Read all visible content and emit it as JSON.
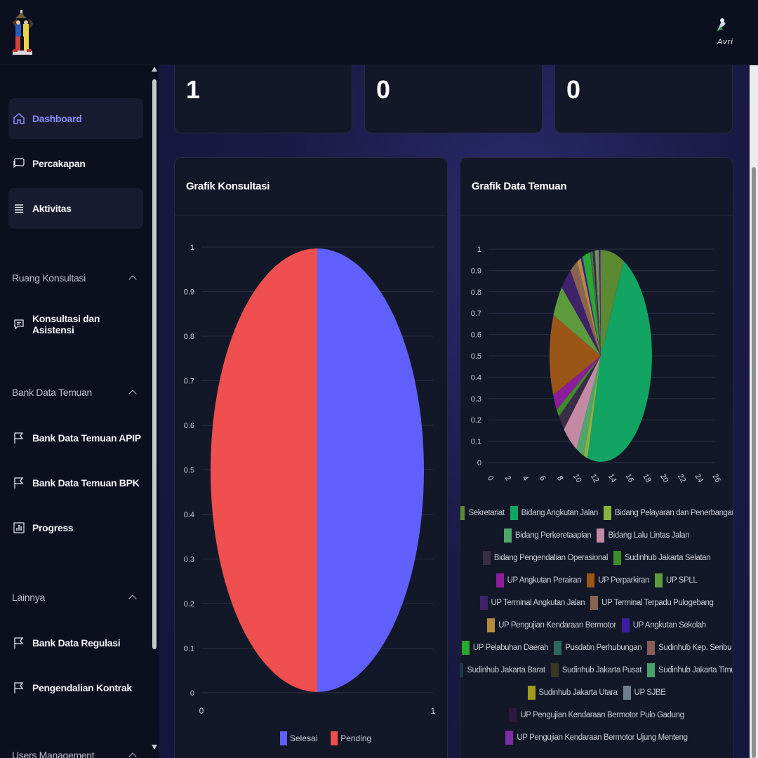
{
  "header": {
    "user_label": "Avri"
  },
  "sidebar": {
    "items": [
      {
        "label": "Dashboard"
      },
      {
        "label": "Percakapan"
      },
      {
        "label": "Aktivitas"
      }
    ],
    "sections": [
      {
        "title": "Ruang Konsultasi",
        "items": [
          {
            "label": "Konsultasi dan Asistensi"
          }
        ]
      },
      {
        "title": "Bank Data Temuan",
        "items": [
          {
            "label": "Bank Data Temuan APIP"
          },
          {
            "label": "Bank Data Temuan BPK"
          },
          {
            "label": "Progress"
          }
        ]
      },
      {
        "title": "Lainnya",
        "items": [
          {
            "label": "Bank Data Regulasi"
          },
          {
            "label": "Pengendalian Kontrak"
          }
        ]
      },
      {
        "title": "Users Management"
      }
    ]
  },
  "stats": [
    {
      "value": "1"
    },
    {
      "value": "0"
    },
    {
      "value": "0"
    }
  ],
  "chart_data": [
    {
      "type": "pie",
      "title": "Grafik Konsultasi",
      "labels": [
        "Selesai",
        "Pending"
      ],
      "values": [
        1,
        1
      ],
      "colors": [
        "#6060ff",
        "#ef4f4f"
      ],
      "y_ticks": [
        "1",
        "0.9",
        "0.8",
        "0.7",
        "0.6",
        "0.5",
        "0.4",
        "0.3",
        "0.2",
        "0.1",
        "0"
      ],
      "x_ticks": [
        "0",
        "1"
      ],
      "legend_position": "bottom"
    },
    {
      "type": "pie",
      "title": "Grafik Data Temuan",
      "labels": [
        "Sekretariat",
        "Bidang Angkutan Jalan",
        "Bidang Pelayaran dan Penerbangan",
        "Bidang Perkeretaapian",
        "Bidang Lalu Lintas Jalan",
        "Bidang Pengendalian Operasional",
        "Sudinhub Jakarta Selatan",
        "UP Angkutan Perairan",
        "UP Perparkiran",
        "UP SPLL",
        "UP Terminal Angkutan Jalan",
        "UP Terminal Terpadu Pulogebang",
        "UP Pengujian Kendaraan Bermotor",
        "UP Angkutan Sekolah",
        "UP Pelabuhan Daerah",
        "Pusdatin Perhubungan",
        "Sudinhub Kep. Seribu",
        "Sudinhub Jakarta Barat",
        "Sudinhub Jakarta Pusat",
        "Sudinhub Jakarta Timur",
        "Sudinhub Jakarta Utara",
        "UP SJBE",
        "UP Pengujian Kendaraan Bermotor Pulo Gadung",
        "UP Pengujian Kendaraan Bermotor Ujung Menteng"
      ],
      "values": [
        6,
        38,
        1,
        2,
        4,
        2,
        1,
        2,
        10,
        4,
        3,
        2,
        1,
        0.5,
        2,
        0.3,
        0.3,
        0.3,
        0.3,
        0.3,
        0.3,
        0.5,
        0.2,
        0.2
      ],
      "colors": [
        "#5b8a32",
        "#11a463",
        "#8bb23e",
        "#4fa66a",
        "#c48aa4",
        "#3a2d46",
        "#3d8b2a",
        "#8d1e9b",
        "#9b5617",
        "#5c9a3d",
        "#40226b",
        "#8a6451",
        "#b88a3c",
        "#3b1ea3",
        "#2aa632",
        "#2d6a5a",
        "#8a5c5a",
        "#1d3a46",
        "#3a3823",
        "#4aa06e",
        "#a29a1c",
        "#6f7f8f",
        "#2e1a3c",
        "#7d2fa6"
      ],
      "y_ticks": [
        "1",
        "0.9",
        "0.8",
        "0.7",
        "0.6",
        "0.5",
        "0.4",
        "0.3",
        "0.2",
        "0.1",
        "0"
      ],
      "x_ticks": [
        "0",
        "2",
        "4",
        "6",
        "8",
        "10",
        "12",
        "14",
        "16",
        "18",
        "20",
        "22",
        "24",
        "26"
      ],
      "legend_position": "bottom"
    }
  ]
}
